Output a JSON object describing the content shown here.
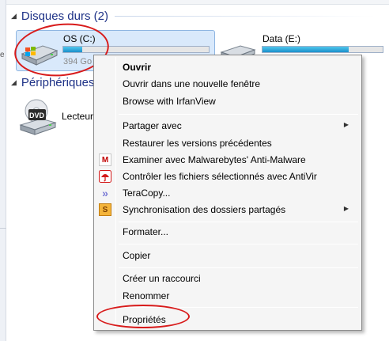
{
  "colors": {
    "group_header": "#1e3287",
    "selection_bg": "#d9e9fb",
    "usage_bar": "#1b8fcb",
    "annotation_ellipse": "#d81b1b",
    "menu_bg": "#f5f5f5"
  },
  "groups": {
    "hard_drives": {
      "label": "Disques durs (2)",
      "arrow_icon": "collapse-triangle-icon"
    },
    "devices": {
      "label": "Périphériques",
      "arrow_icon": "collapse-triangle-icon"
    }
  },
  "drives": {
    "c": {
      "name": "OS (C:)",
      "free_text": "394 Go",
      "used_fraction": 0.13,
      "icon": "windows-hard-drive-icon",
      "selected": true
    },
    "e": {
      "name": "Data (E:)",
      "used_fraction": 0.72,
      "icon": "hard-drive-icon"
    }
  },
  "devices": {
    "dvd": {
      "name": "Lecteur",
      "icon": "dvd-drive-icon",
      "badge": "DVD"
    }
  },
  "context_menu": {
    "items": [
      {
        "label": "Ouvrir",
        "bold": true
      },
      {
        "label": "Ouvrir dans une nouvelle fenêtre"
      },
      {
        "label": "Browse with IrfanView"
      },
      {
        "label": "Partager avec",
        "submenu": true
      },
      {
        "label": "Restaurer les versions précédentes"
      },
      {
        "label": "Examiner avec Malwarebytes' Anti-Malware",
        "icon": "malwarebytes-icon",
        "icon_glyph": "M"
      },
      {
        "label": "Contrôler les fichiers sélectionnés avec AntiVir",
        "icon": "antivir-umbrella-icon"
      },
      {
        "label": "TeraCopy...",
        "icon": "teracopy-icon",
        "icon_glyph": "»"
      },
      {
        "label": "Synchronisation des dossiers partagés",
        "icon": "sync-folders-icon",
        "icon_glyph": "S",
        "submenu": true
      },
      {
        "label": "Formater..."
      },
      {
        "label": "Copier"
      },
      {
        "label": "Créer un raccourci"
      },
      {
        "label": "Renommer"
      },
      {
        "label": "Propriétés"
      }
    ]
  }
}
